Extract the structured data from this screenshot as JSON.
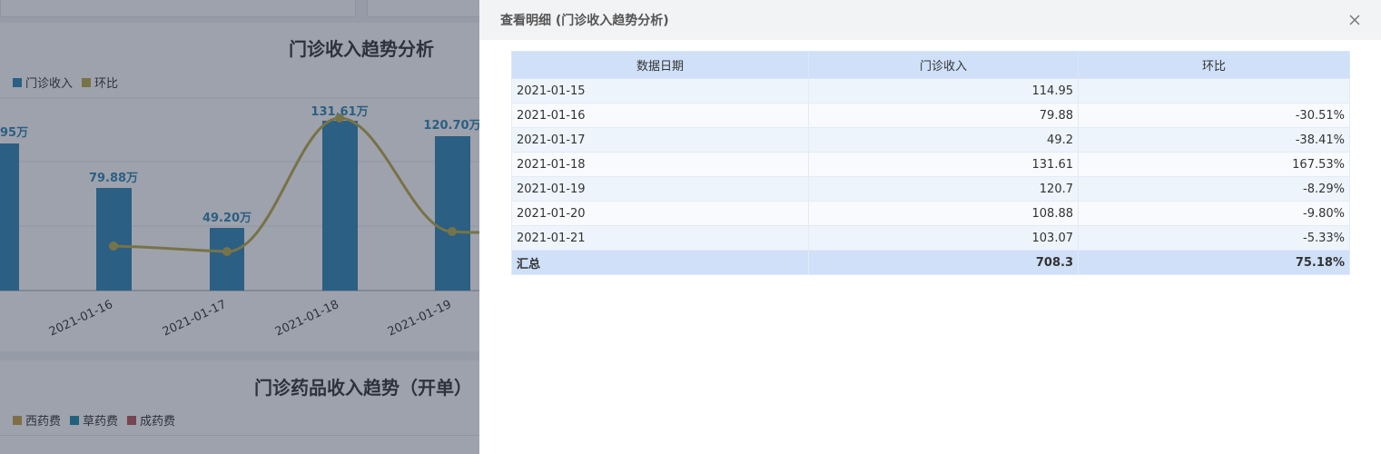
{
  "background": {
    "panel1": {
      "title": "门诊收入趋势分析",
      "legend": [
        {
          "label": "门诊收入",
          "color": "#2e86b5"
        },
        {
          "label": "环比",
          "color": "#b8a94a"
        }
      ],
      "bar_labels": [
        "95万",
        "79.88万",
        "49.20万",
        "131.61万",
        "120.70万"
      ],
      "x_labels": [
        "2021-01-16",
        "2021-01-17",
        "2021-01-18",
        "2021-01-19"
      ]
    },
    "panel2": {
      "title": "门诊药品收入趋势（开单）",
      "legend": [
        {
          "label": "西药费",
          "color": "#c9a14a"
        },
        {
          "label": "草药费",
          "color": "#1b8aa6"
        },
        {
          "label": "成药费",
          "color": "#b5575a"
        }
      ]
    }
  },
  "chart_data": {
    "type": "bar",
    "title": "门诊收入趋势分析",
    "categories": [
      "2021-01-15",
      "2021-01-16",
      "2021-01-17",
      "2021-01-18",
      "2021-01-19",
      "2021-01-20"
    ],
    "series": [
      {
        "name": "门诊收入",
        "values": [
          114.95,
          79.88,
          49.2,
          131.61,
          120.7,
          108.88
        ]
      },
      {
        "name": "环比",
        "values": [
          null,
          -30.51,
          -38.41,
          167.53,
          -8.29,
          -9.8
        ]
      }
    ]
  },
  "drawer": {
    "title": "查看明细 (门诊收入趋势分析)",
    "columns": [
      "数据日期",
      "门诊收入",
      "环比"
    ],
    "rows": [
      {
        "date": "2021-01-15",
        "income": "114.95",
        "ratio": ""
      },
      {
        "date": "2021-01-16",
        "income": "79.88",
        "ratio": "-30.51%"
      },
      {
        "date": "2021-01-17",
        "income": "49.2",
        "ratio": "-38.41%"
      },
      {
        "date": "2021-01-18",
        "income": "131.61",
        "ratio": "167.53%"
      },
      {
        "date": "2021-01-19",
        "income": "120.7",
        "ratio": "-8.29%"
      },
      {
        "date": "2021-01-20",
        "income": "108.88",
        "ratio": "-9.80%"
      },
      {
        "date": "2021-01-21",
        "income": "103.07",
        "ratio": "-5.33%"
      }
    ],
    "total": {
      "label": "汇总",
      "income": "708.3",
      "ratio": "75.18%"
    }
  }
}
